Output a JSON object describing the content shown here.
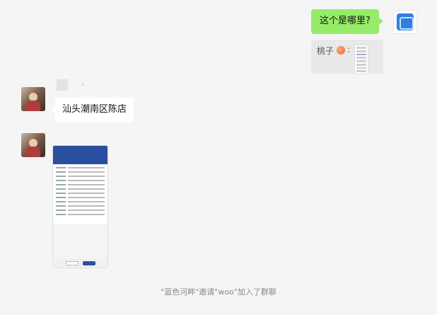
{
  "messages": {
    "me_question": "这个是哪里?",
    "quote": {
      "sender": "桃子",
      "separator": ":",
      "icon": "peach-icon"
    },
    "other_answer": "汕头潮南区陈店",
    "other_image": {
      "icon": "phone-screenshot-image"
    }
  },
  "system": {
    "notice": "\"蓝色河畔\"邀请\"woo\"加入了群聊"
  },
  "colors": {
    "me_bubble": "#95ec69",
    "other_bubble": "#ffffff",
    "background": "#f5f5f5"
  }
}
